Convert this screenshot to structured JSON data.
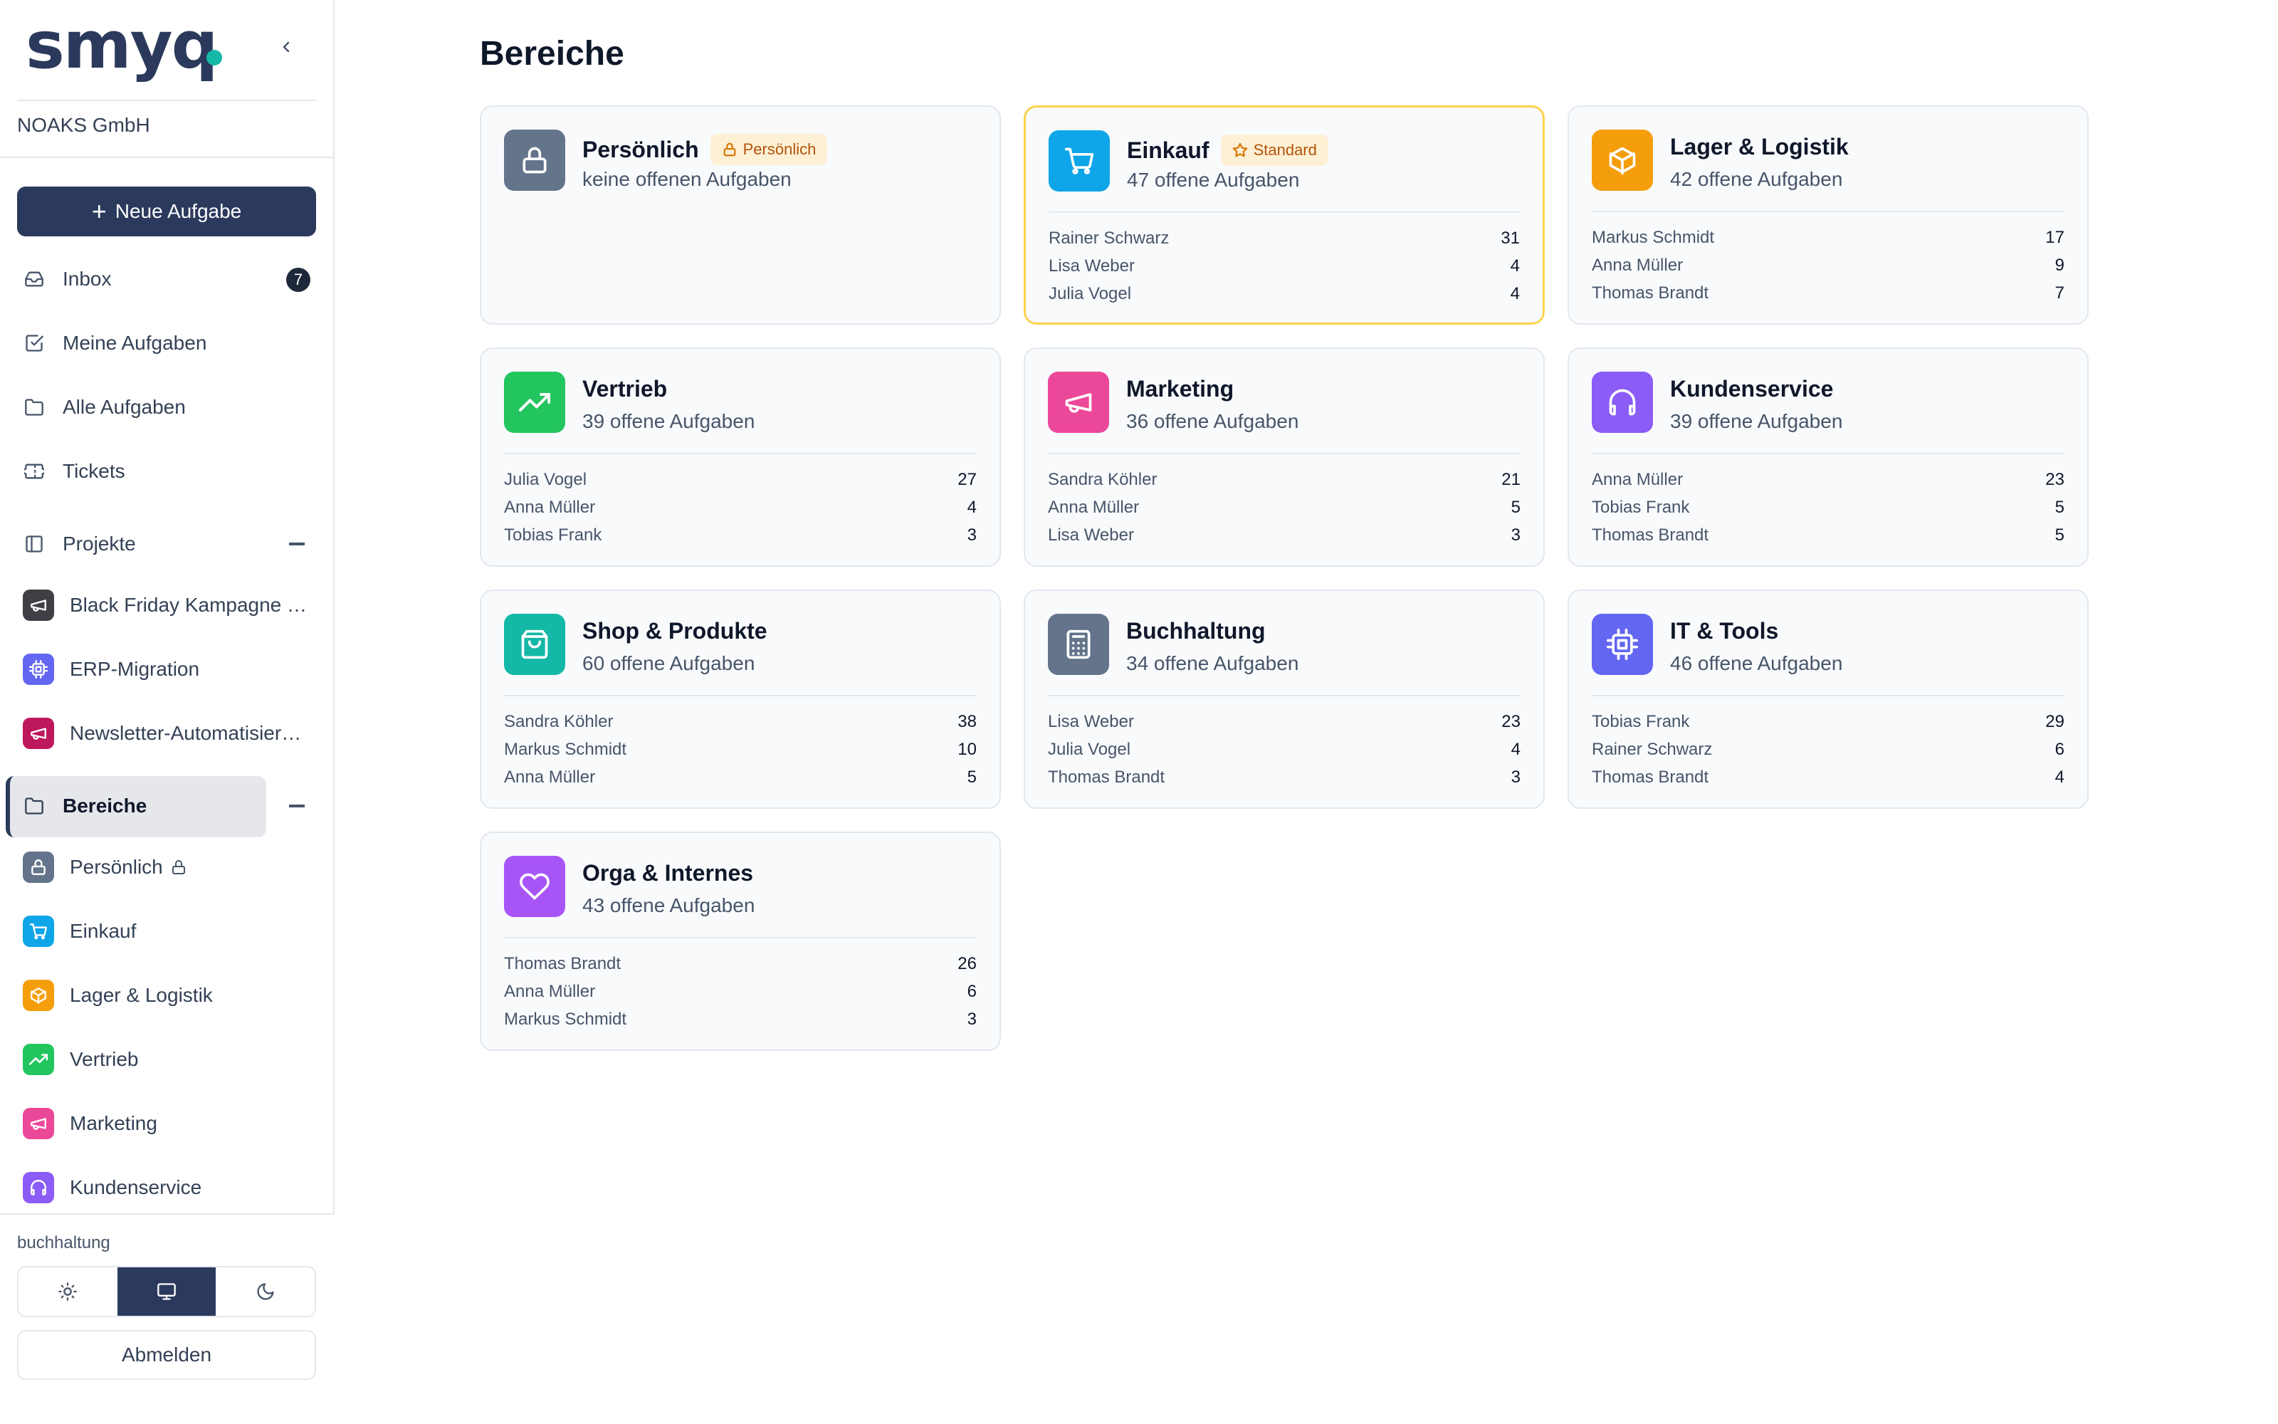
{
  "app": {
    "logo": "smyq",
    "company": "NOAKS GmbH"
  },
  "sidebar": {
    "new_task_label": "Neue Aufgabe",
    "nav": [
      {
        "label": "Inbox",
        "icon": "inbox-icon",
        "badge": "7"
      },
      {
        "label": "Meine Aufgaben",
        "icon": "checkbox-icon"
      },
      {
        "label": "Alle Aufgaben",
        "icon": "folder-icon"
      },
      {
        "label": "Tickets",
        "icon": "ticket-icon"
      }
    ],
    "projects_label": "Projekte",
    "projects": [
      {
        "label": "Black Friday Kampagne …",
        "color": "#3f3f46",
        "icon": "megaphone-icon"
      },
      {
        "label": "ERP-Migration",
        "color": "#6366f1",
        "icon": "cpu-icon"
      },
      {
        "label": "Newsletter-Automatisier…",
        "color": "#be185d",
        "icon": "megaphone-icon"
      }
    ],
    "areas_label": "Bereiche",
    "areas": [
      {
        "label": "Persönlich",
        "color": "#64748b",
        "icon": "lock-icon",
        "locked": true
      },
      {
        "label": "Einkauf",
        "color": "#0ea5e9",
        "icon": "cart-icon"
      },
      {
        "label": "Lager & Logistik",
        "color": "#f59e0b",
        "icon": "box-icon"
      },
      {
        "label": "Vertrieb",
        "color": "#22c55e",
        "icon": "trending-up-icon"
      },
      {
        "label": "Marketing",
        "color": "#ec4899",
        "icon": "megaphone-icon"
      },
      {
        "label": "Kundenservice",
        "color": "#8b5cf6",
        "icon": "headphones-icon"
      }
    ],
    "department": "buchhaltung",
    "theme_options": [
      "sun-icon",
      "monitor-icon",
      "moon-icon"
    ],
    "theme_active": "monitor-icon",
    "logout_label": "Abmelden"
  },
  "main": {
    "title": "Bereiche",
    "cards": [
      {
        "name": "Persönlich",
        "color": "#64748b",
        "icon": "lock-icon",
        "tag": "Persönlich",
        "tag_icon": "lock-icon",
        "subtitle": "keine offenen Aufgaben",
        "people": []
      },
      {
        "name": "Einkauf",
        "color": "#0ea5e9",
        "icon": "cart-icon",
        "tag": "Standard",
        "tag_icon": "star-icon",
        "highlight": true,
        "subtitle": "47 offene Aufgaben",
        "people": [
          {
            "name": "Rainer Schwarz",
            "count": "31"
          },
          {
            "name": "Lisa Weber",
            "count": "4"
          },
          {
            "name": "Julia Vogel",
            "count": "4"
          }
        ]
      },
      {
        "name": "Lager & Logistik",
        "color": "#f59e0b",
        "icon": "box-icon",
        "subtitle": "42 offene Aufgaben",
        "people": [
          {
            "name": "Markus Schmidt",
            "count": "17"
          },
          {
            "name": "Anna Müller",
            "count": "9"
          },
          {
            "name": "Thomas Brandt",
            "count": "7"
          }
        ]
      },
      {
        "name": "Vertrieb",
        "color": "#22c55e",
        "icon": "trending-up-icon",
        "subtitle": "39 offene Aufgaben",
        "people": [
          {
            "name": "Julia Vogel",
            "count": "27"
          },
          {
            "name": "Anna Müller",
            "count": "4"
          },
          {
            "name": "Tobias Frank",
            "count": "3"
          }
        ]
      },
      {
        "name": "Marketing",
        "color": "#ec4899",
        "icon": "megaphone-icon",
        "subtitle": "36 offene Aufgaben",
        "people": [
          {
            "name": "Sandra Köhler",
            "count": "21"
          },
          {
            "name": "Anna Müller",
            "count": "5"
          },
          {
            "name": "Lisa Weber",
            "count": "3"
          }
        ]
      },
      {
        "name": "Kundenservice",
        "color": "#8b5cf6",
        "icon": "headphones-icon",
        "subtitle": "39 offene Aufgaben",
        "people": [
          {
            "name": "Anna Müller",
            "count": "23"
          },
          {
            "name": "Tobias Frank",
            "count": "5"
          },
          {
            "name": "Thomas Brandt",
            "count": "5"
          }
        ]
      },
      {
        "name": "Shop & Produkte",
        "color": "#14b8a6",
        "icon": "shopping-bag-icon",
        "subtitle": "60 offene Aufgaben",
        "people": [
          {
            "name": "Sandra Köhler",
            "count": "38"
          },
          {
            "name": "Markus Schmidt",
            "count": "10"
          },
          {
            "name": "Anna Müller",
            "count": "5"
          }
        ]
      },
      {
        "name": "Buchhaltung",
        "color": "#64748b",
        "icon": "calculator-icon",
        "subtitle": "34 offene Aufgaben",
        "people": [
          {
            "name": "Lisa Weber",
            "count": "23"
          },
          {
            "name": "Julia Vogel",
            "count": "4"
          },
          {
            "name": "Thomas Brandt",
            "count": "3"
          }
        ]
      },
      {
        "name": "IT & Tools",
        "color": "#6366f1",
        "icon": "cpu-icon",
        "subtitle": "46 offene Aufgaben",
        "people": [
          {
            "name": "Tobias Frank",
            "count": "29"
          },
          {
            "name": "Rainer Schwarz",
            "count": "6"
          },
          {
            "name": "Thomas Brandt",
            "count": "4"
          }
        ]
      },
      {
        "name": "Orga & Internes",
        "color": "#a855f7",
        "icon": "heart-icon",
        "subtitle": "43 offene Aufgaben",
        "people": [
          {
            "name": "Thomas Brandt",
            "count": "26"
          },
          {
            "name": "Anna Müller",
            "count": "6"
          },
          {
            "name": "Markus Schmidt",
            "count": "3"
          }
        ]
      }
    ]
  }
}
